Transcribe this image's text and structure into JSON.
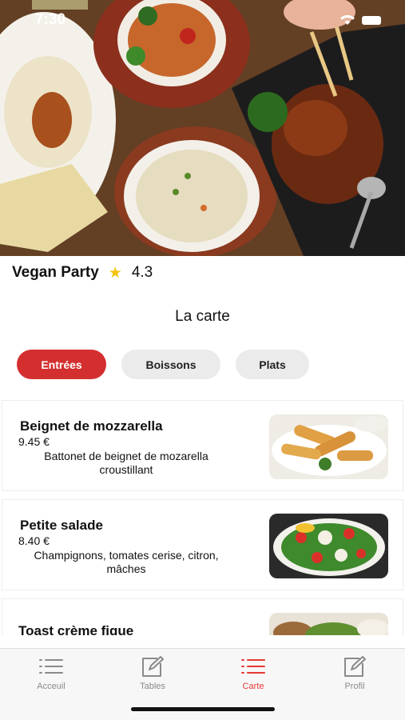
{
  "status_bar": {
    "time": "7:30"
  },
  "restaurant": {
    "name": "Vegan Party",
    "rating": "4.3"
  },
  "menu_title": "La carte",
  "categories": [
    {
      "label": "Entrées",
      "active": true
    },
    {
      "label": "Boissons",
      "active": false
    },
    {
      "label": "Plats",
      "active": false
    }
  ],
  "items": [
    {
      "name": "Beignet de mozzarella",
      "price": "9.45 €",
      "description": "Battonet de beignet de mozarella croustillant"
    },
    {
      "name": "Petite salade",
      "price": "8.40 €",
      "description": "Champignons, tomates cerise, citron, mâches"
    },
    {
      "name": "Toast crème figue",
      "price": "",
      "description": ""
    }
  ],
  "tabbar": [
    {
      "label": "Acceuil",
      "icon": "list-icon",
      "active": false
    },
    {
      "label": "Tables",
      "icon": "edit-icon",
      "active": false
    },
    {
      "label": "Carte",
      "icon": "list-icon",
      "active": true
    },
    {
      "label": "Profil",
      "icon": "edit-icon",
      "active": false
    }
  ],
  "colors": {
    "accent": "#d32f2f",
    "tab_active": "#e53935",
    "star": "#f4c20d"
  }
}
